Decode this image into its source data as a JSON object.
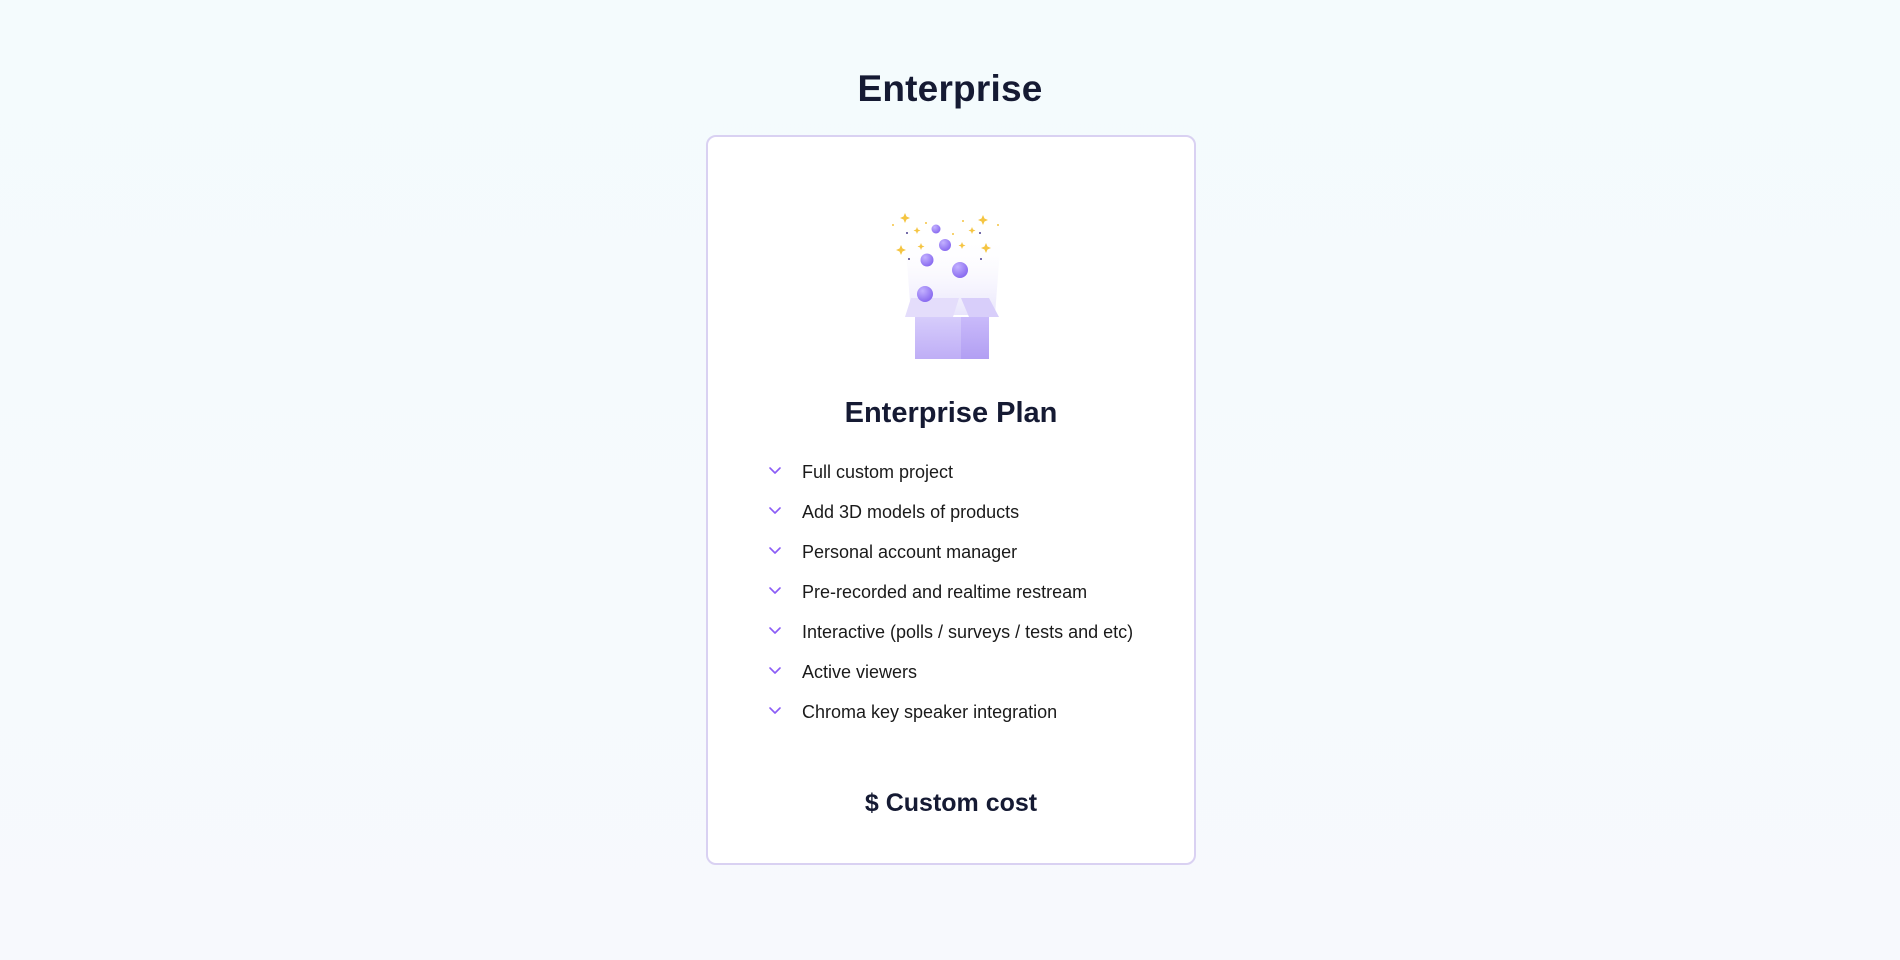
{
  "page": {
    "title": "Enterprise"
  },
  "card": {
    "illustration_icon": "open-gift-box-confetti-icon",
    "plan_title": "Enterprise Plan",
    "features": [
      "Full custom project",
      "Add 3D models of products",
      "Personal account manager",
      "Pre-recorded and realtime restream",
      "Interactive (polls / surveys / tests and etc)",
      "Active viewers",
      "Chroma key speaker integration"
    ],
    "price": "$ Custom cost"
  },
  "colors": {
    "accent": "#8b5cf6",
    "card_border": "#d9d1f2",
    "heading": "#151a33",
    "sparkle": "#f5c542"
  }
}
